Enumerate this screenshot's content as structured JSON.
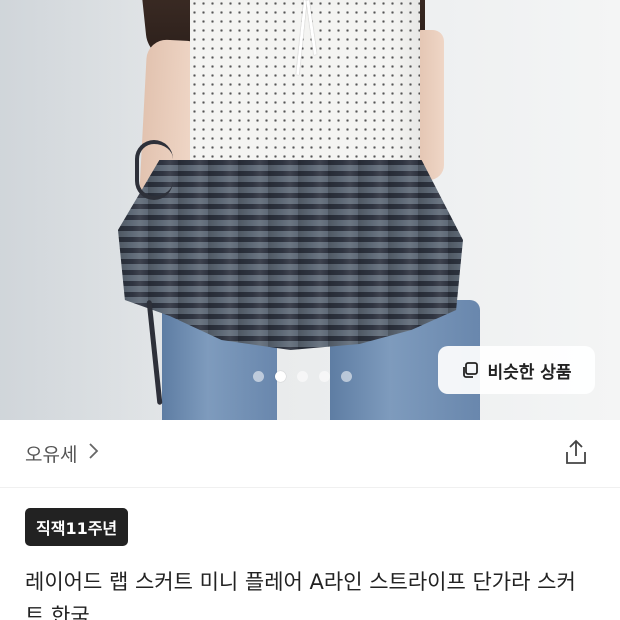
{
  "product_image": {
    "pager": {
      "count": 5,
      "active_index": 1
    },
    "similar_button": {
      "label": "비슷한 상품",
      "icon": "copy-icon"
    }
  },
  "seller": {
    "name": "오유세",
    "icon": "chevron-right-icon"
  },
  "share": {
    "icon": "share-icon"
  },
  "badge": {
    "label": "직잭11주년"
  },
  "product": {
    "title": "레이어드 랩 스커트 미니 플레어 A라인 스트라이프 단가라 스커트 한국"
  },
  "colors": {
    "badge_bg": "#222222",
    "skirt_dark": "#2e3440",
    "skirt_light": "#5f6a77"
  }
}
